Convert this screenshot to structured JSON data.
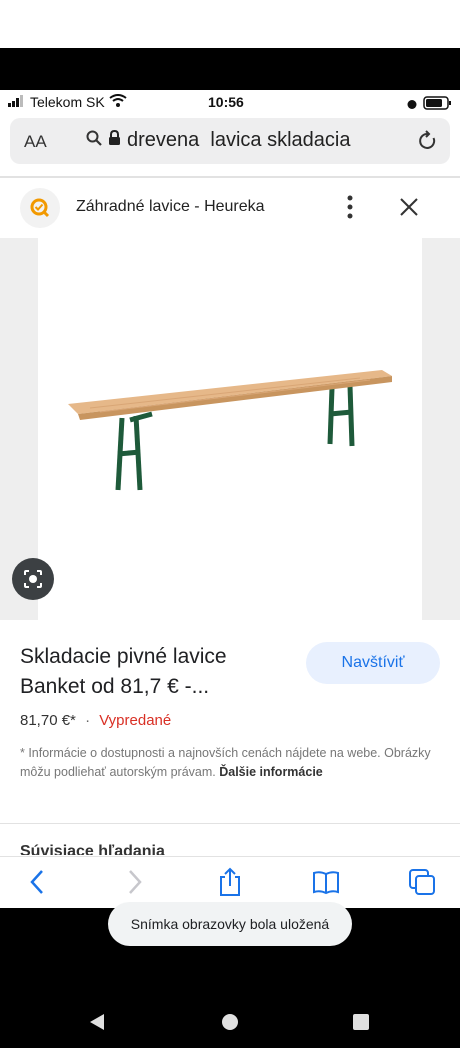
{
  "status_bar": {
    "carrier": "Telekom SK",
    "time": "10:56"
  },
  "url_bar": {
    "text_size_label": "AA",
    "query": "drevena  lavica skladacia"
  },
  "sheet": {
    "title": "Záhradné lavice - Heureka"
  },
  "product": {
    "title": "Skladacie pivné lavice Banket od 81,7 € -...",
    "visit_label": "Navštíviť",
    "price": "81,70 €*",
    "separator": "·",
    "availability": "Vypredané",
    "disclaimer": "* Informácie o dostupnosti a najnovších cenách nájdete na webe. Obrázky môžu podliehať autorským právam.",
    "more_info": "Ďalšie informácie",
    "partial_next": "Súvisiace hľadania"
  },
  "toast": {
    "text": "Snímka obrazovky bola uložená"
  },
  "colors": {
    "accent": "#1a73e8",
    "sold_out": "#d93025",
    "bench_legs": "#1e5a3a",
    "bench_wood": "#e6b889"
  },
  "icons": [
    "signal-icon",
    "wifi-icon",
    "search-icon",
    "lock-icon",
    "reload-icon",
    "heureka-logo-icon",
    "more-vert-icon",
    "close-icon",
    "lens-icon",
    "back-icon",
    "forward-icon",
    "share-icon",
    "bookmarks-icon",
    "tabs-icon",
    "nav-back-icon",
    "nav-home-icon",
    "nav-recents-icon"
  ]
}
